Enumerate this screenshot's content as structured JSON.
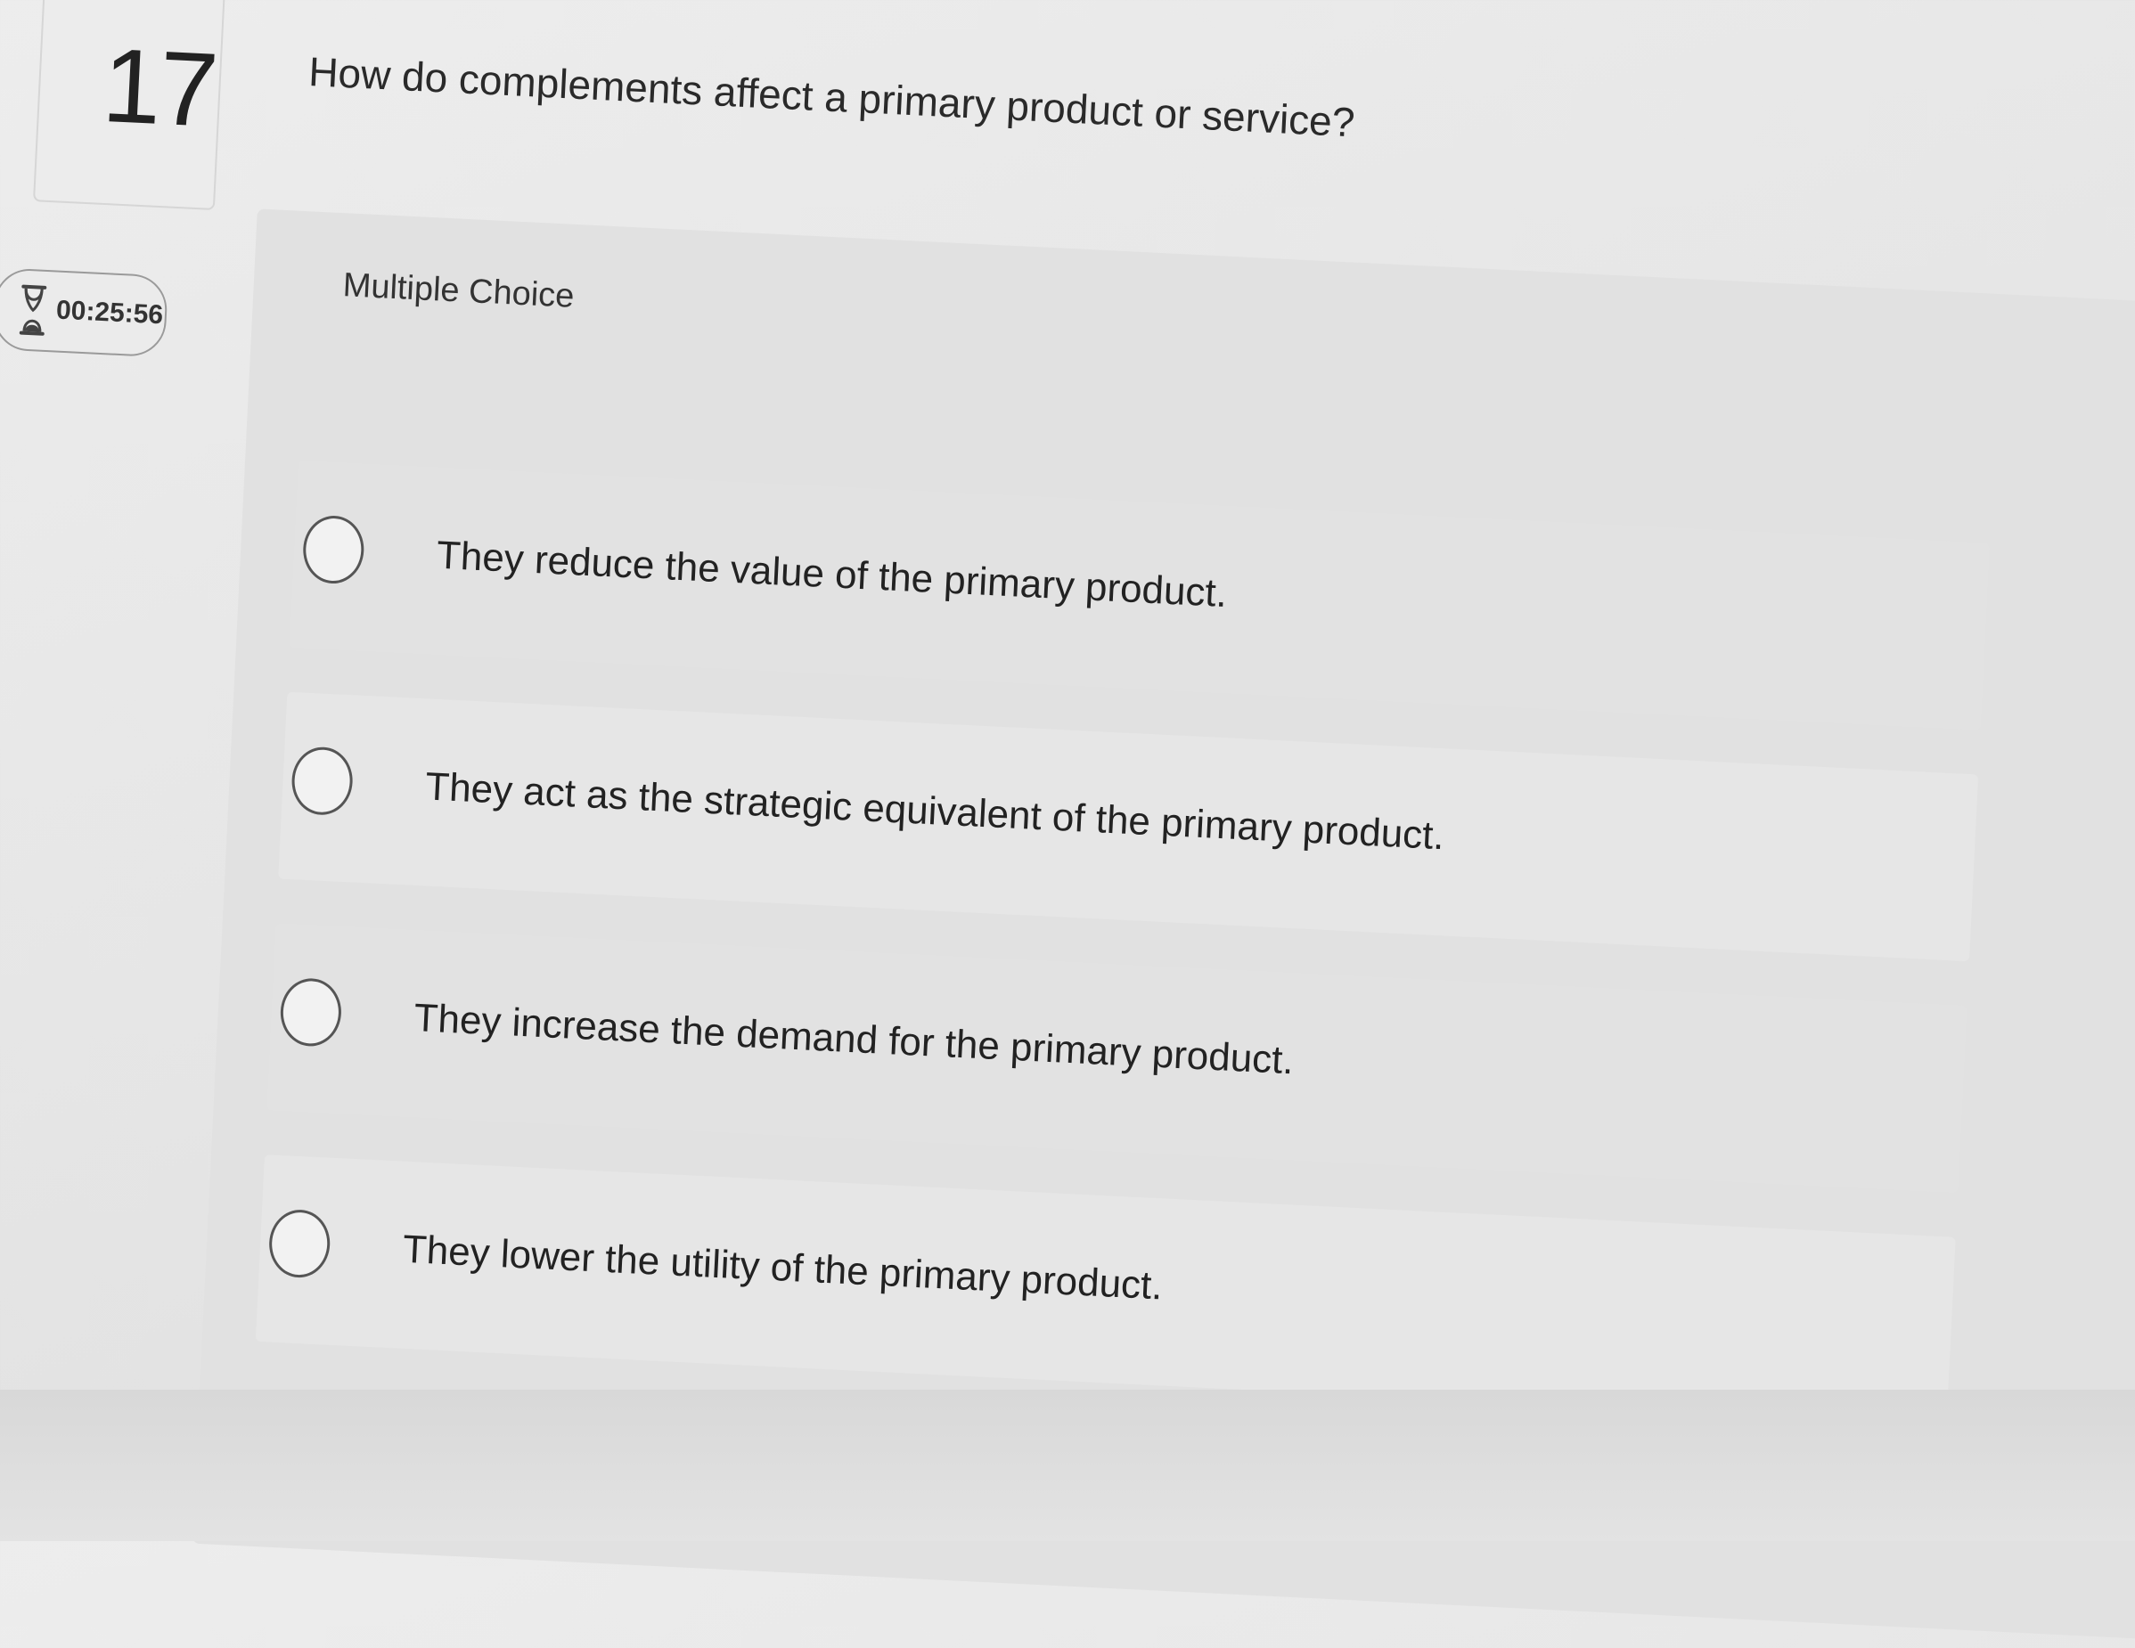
{
  "question": {
    "number": "17",
    "text": "How do complements affect a primary product or service?",
    "type_label": "Multiple Choice"
  },
  "timer": {
    "icon": "hourglass-icon",
    "time": "00:25:56"
  },
  "options": [
    {
      "label": "They reduce the value of the primary product."
    },
    {
      "label": "They act as the strategic equivalent of the primary product."
    },
    {
      "label": "They increase the demand for the primary product."
    },
    {
      "label": "They lower the utility of the primary product."
    }
  ],
  "colors": {
    "background": "#e6e6e6",
    "text": "#2a2a2a",
    "radio_border": "#555555"
  }
}
